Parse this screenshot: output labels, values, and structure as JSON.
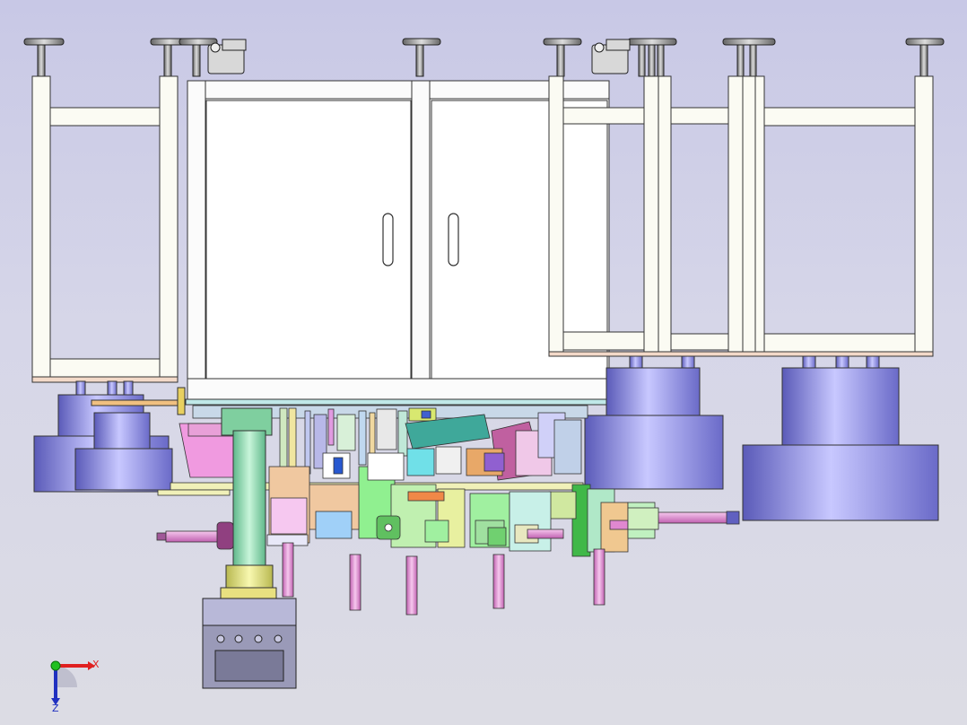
{
  "viewport": {
    "background_top": "#c8c8e6",
    "background_bottom": "#dcdce4",
    "model_view": "front"
  },
  "triad": {
    "x_label": "X",
    "z_label": "Z",
    "x_color": "#e02020",
    "z_color": "#2030c0",
    "y_color": "#20c020"
  },
  "colors": {
    "frame_fill": "#fbfbf3",
    "frame_stroke": "#333333",
    "cabinet_fill": "#ffffff",
    "motor_blue": "#8a8ae8",
    "column_green": "#9fe3b5",
    "cylinder_pink": "#e99ad8",
    "plate_magenta": "#e07ad0",
    "control_box": "#9a9ab8"
  }
}
